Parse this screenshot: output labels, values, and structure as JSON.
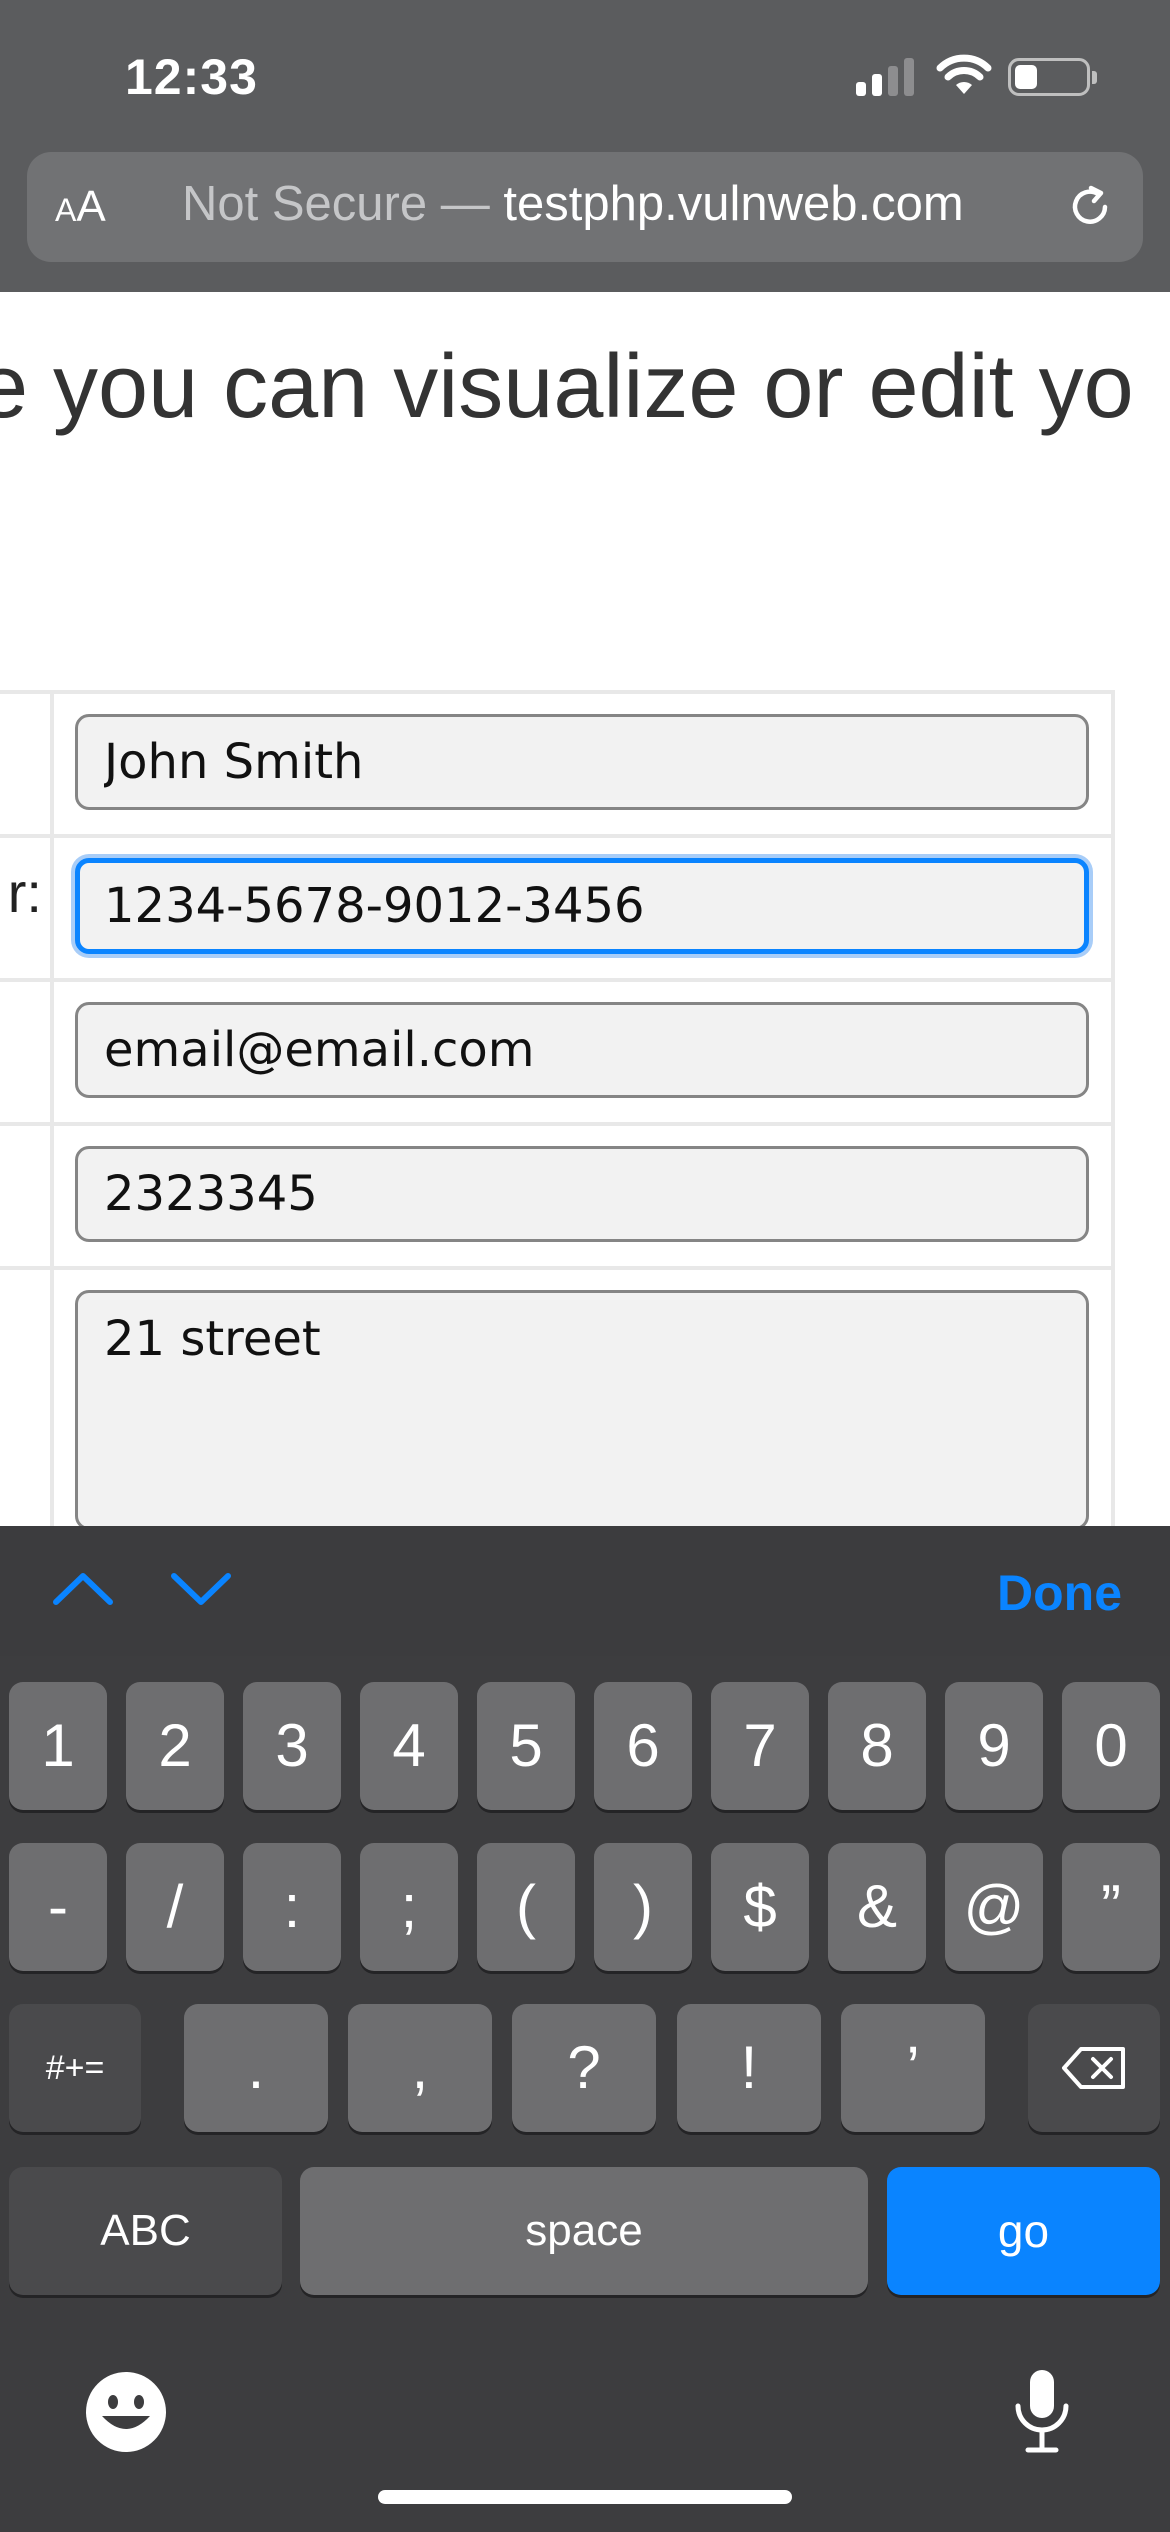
{
  "status_bar": {
    "time": "12:33"
  },
  "browser": {
    "aa_small": "A",
    "aa_big": "A",
    "security_label": "Not Secure — ",
    "host": "testphp.vulnweb.com"
  },
  "page": {
    "heading": "e you can visualize or edit yo"
  },
  "form": {
    "card_label_fragment": "r:",
    "name_value": "John Smith",
    "card_value": "1234-5678-9012-3456",
    "email_value": "email@email.com",
    "phone_value": "2323345",
    "address_value": "21 street"
  },
  "accessory": {
    "done_label": "Done"
  },
  "keyboard": {
    "row1": [
      "1",
      "2",
      "3",
      "4",
      "5",
      "6",
      "7",
      "8",
      "9",
      "0"
    ],
    "row2": [
      "-",
      "/",
      ":",
      ";",
      "(",
      ")",
      "$",
      "&",
      "@",
      "”"
    ],
    "row3_left": "#+=",
    "row3": [
      ".",
      ",",
      "?",
      "!",
      "’"
    ],
    "abc_label": "ABC",
    "space_label": "space",
    "go_label": "go"
  },
  "colors": {
    "accent": "#0a84ff"
  }
}
